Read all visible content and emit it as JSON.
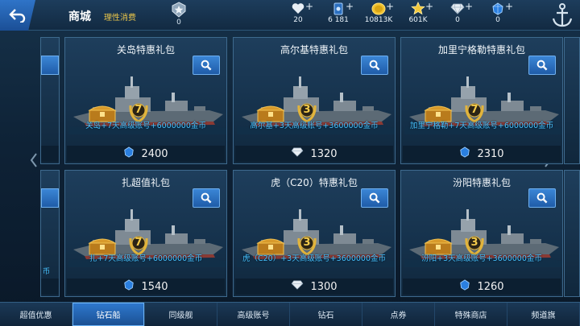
{
  "header": {
    "title": "商城",
    "subtitle": "理性消费",
    "rank_value": "0"
  },
  "resources": [
    {
      "name": "heart-icon",
      "value": "20"
    },
    {
      "name": "card-icon",
      "value": "6 181"
    },
    {
      "name": "gold-coin-icon",
      "value": "10813K"
    },
    {
      "name": "star-icon",
      "value": "601K"
    },
    {
      "name": "diamond-icon",
      "value": "0"
    },
    {
      "name": "blue-crystal-icon",
      "value": "0"
    }
  ],
  "cards": [
    {
      "title": "关岛特惠礼包",
      "desc": "关岛+7天高级账号+6000000金币",
      "badge": "7",
      "currency": "blue-crystal-icon",
      "price": "2400"
    },
    {
      "title": "高尔基特惠礼包",
      "desc": "高尔基+3天高级账号+3600000金币",
      "badge": "3",
      "currency": "diamond-icon",
      "price": "1320"
    },
    {
      "title": "加里宁格勒特惠礼包",
      "desc": "加里宁格勒+7天高级账号+6000000金币",
      "badge": "7",
      "currency": "blue-crystal-icon",
      "price": "2310"
    },
    {
      "title": "扎超值礼包",
      "desc": "扎+7天高级账号+6000000金币",
      "badge": "7",
      "currency": "blue-crystal-icon",
      "price": "1540"
    },
    {
      "title": "虎（C20）特惠礼包",
      "desc": "虎（C20）+3天高级账号+3600000金币",
      "badge": "3",
      "currency": "diamond-icon",
      "price": "1300"
    },
    {
      "title": "汾阳特惠礼包",
      "desc": "汾阳+3天高级账号+3600000金币",
      "badge": "3",
      "currency": "blue-crystal-icon",
      "price": "1260"
    }
  ],
  "partial_left_text": "币",
  "tabs": [
    {
      "label": "超值优惠",
      "active": false
    },
    {
      "label": "钻石船",
      "active": true
    },
    {
      "label": "同级舰",
      "active": false
    },
    {
      "label": "高级账号",
      "active": false
    },
    {
      "label": "钻石",
      "active": false
    },
    {
      "label": "点券",
      "active": false
    },
    {
      "label": "特殊商店",
      "active": false
    },
    {
      "label": "频道旗",
      "active": false
    }
  ],
  "colors": {
    "accent": "#2f79cf",
    "desc_text": "#47c2ff",
    "subtitle": "#e8c54a"
  }
}
